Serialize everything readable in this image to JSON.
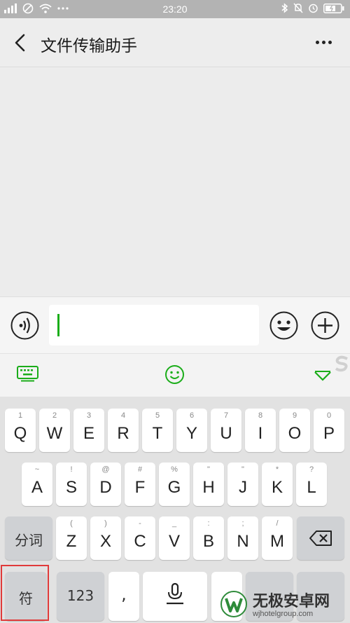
{
  "status_bar": {
    "time": "23:20"
  },
  "header": {
    "title": "文件传输助手"
  },
  "input": {
    "value": ""
  },
  "keyboard": {
    "row1": [
      {
        "hint": "1",
        "key": "Q"
      },
      {
        "hint": "2",
        "key": "W"
      },
      {
        "hint": "3",
        "key": "E"
      },
      {
        "hint": "4",
        "key": "R"
      },
      {
        "hint": "5",
        "key": "T"
      },
      {
        "hint": "6",
        "key": "Y"
      },
      {
        "hint": "7",
        "key": "U"
      },
      {
        "hint": "8",
        "key": "I"
      },
      {
        "hint": "9",
        "key": "O"
      },
      {
        "hint": "0",
        "key": "P"
      }
    ],
    "row2": [
      {
        "hint": "~",
        "key": "A"
      },
      {
        "hint": "!",
        "key": "S"
      },
      {
        "hint": "@",
        "key": "D"
      },
      {
        "hint": "#",
        "key": "F"
      },
      {
        "hint": "%",
        "key": "G"
      },
      {
        "hint": "\"",
        "key": "H"
      },
      {
        "hint": "\"",
        "key": "J"
      },
      {
        "hint": "*",
        "key": "K"
      },
      {
        "hint": "?",
        "key": "L"
      }
    ],
    "row3": [
      {
        "hint": "(",
        "key": "Z"
      },
      {
        "hint": ")",
        "key": "X"
      },
      {
        "hint": "-",
        "key": "C"
      },
      {
        "hint": "_",
        "key": "V"
      },
      {
        "hint": ":",
        "key": "B"
      },
      {
        "hint": ";",
        "key": "N"
      },
      {
        "hint": "/",
        "key": "M"
      }
    ],
    "fenci_label": "分词",
    "symbol_label": "符",
    "num_label": "123",
    "comma_label": ","
  },
  "watermark": {
    "name": "无极安卓网",
    "url": "wjhotelgroup.com"
  },
  "colors": {
    "accent": "#1aad19",
    "highlight": "#e03a3a"
  }
}
